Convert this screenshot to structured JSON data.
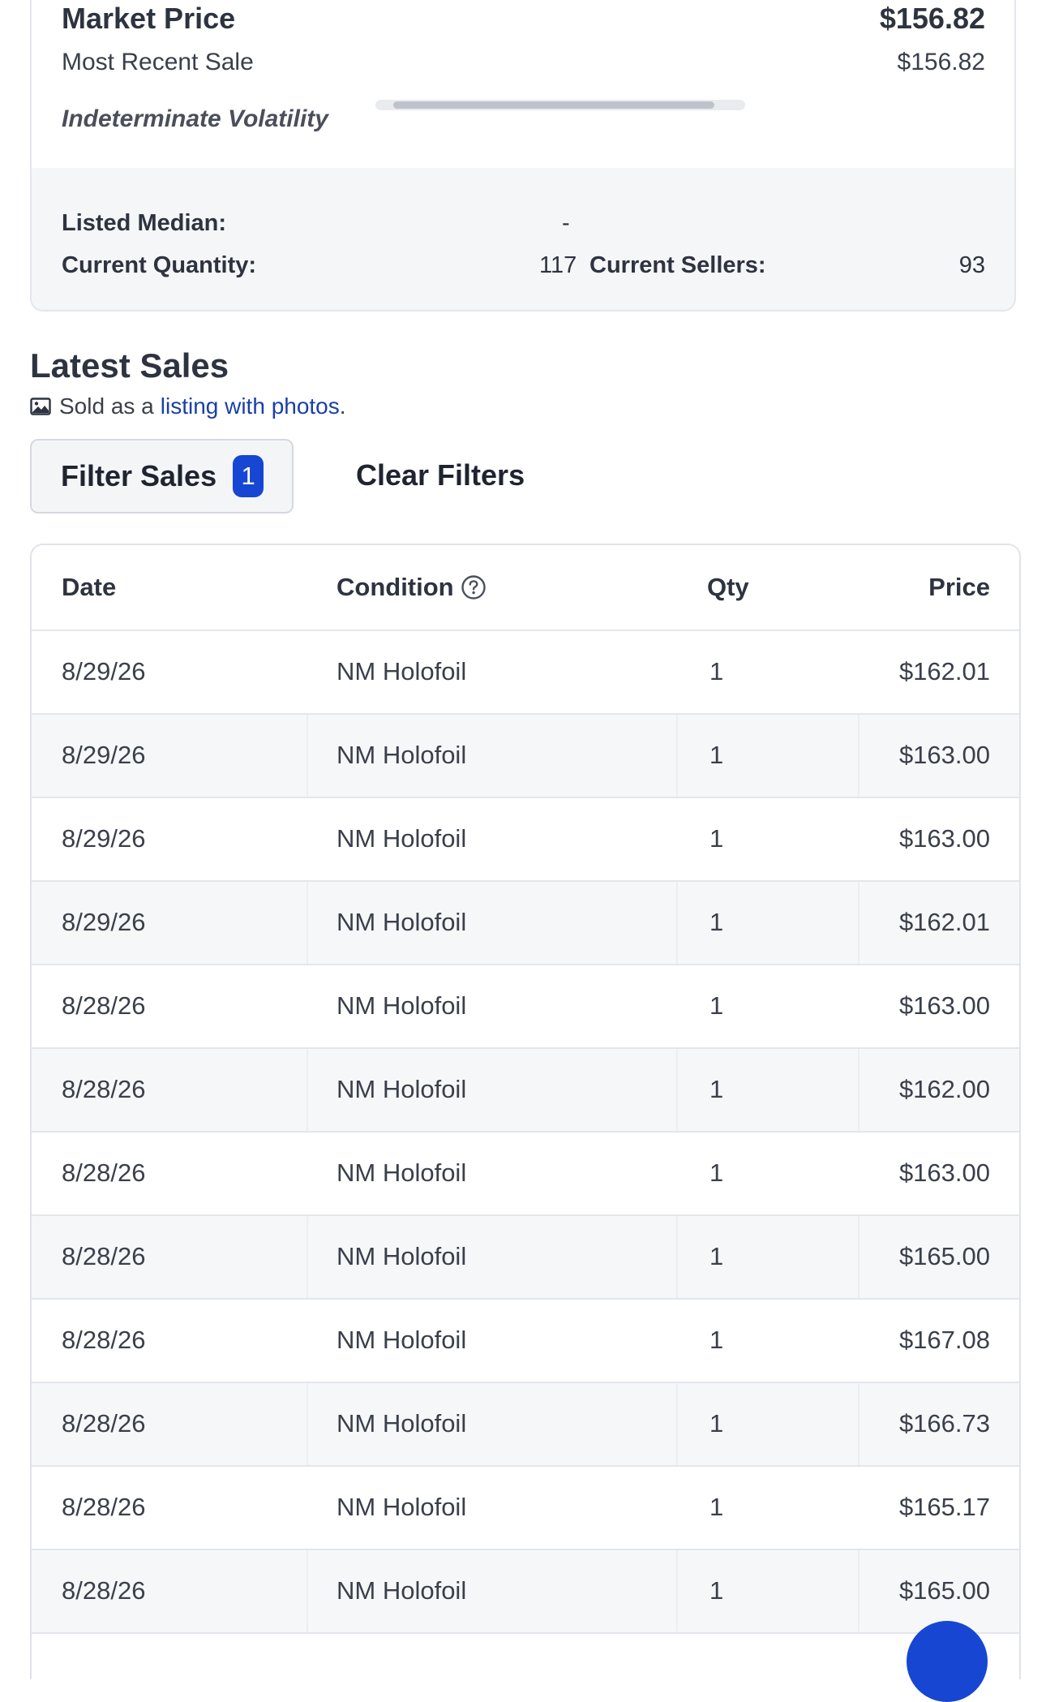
{
  "market": {
    "label": "Market Price",
    "value": "$156.82",
    "recent_label": "Most Recent Sale",
    "recent_value": "$156.82",
    "volatility_label": "Indeterminate Volatility",
    "volatility_level": 0.9
  },
  "stats": {
    "listed_median_label": "Listed Median:",
    "listed_median_value": "-",
    "quantity_label": "Current Quantity:",
    "quantity_value": "117",
    "sellers_label": "Current Sellers:",
    "sellers_value": "93"
  },
  "sales": {
    "title": "Latest Sales",
    "note_prefix": "Sold as a",
    "note_link": "listing with photos",
    "note_suffix": ".",
    "filter_label": "Filter Sales",
    "filter_count": "1",
    "clear_label": "Clear Filters",
    "columns": {
      "date": "Date",
      "condition": "Condition",
      "qty": "Qty",
      "price": "Price"
    },
    "rows": [
      {
        "date": "8/29/26",
        "condition": "NM Holofoil",
        "qty": "1",
        "price": "$162.01"
      },
      {
        "date": "8/29/26",
        "condition": "NM Holofoil",
        "qty": "1",
        "price": "$163.00"
      },
      {
        "date": "8/29/26",
        "condition": "NM Holofoil",
        "qty": "1",
        "price": "$163.00"
      },
      {
        "date": "8/29/26",
        "condition": "NM Holofoil",
        "qty": "1",
        "price": "$162.01"
      },
      {
        "date": "8/28/26",
        "condition": "NM Holofoil",
        "qty": "1",
        "price": "$163.00"
      },
      {
        "date": "8/28/26",
        "condition": "NM Holofoil",
        "qty": "1",
        "price": "$162.00"
      },
      {
        "date": "8/28/26",
        "condition": "NM Holofoil",
        "qty": "1",
        "price": "$163.00"
      },
      {
        "date": "8/28/26",
        "condition": "NM Holofoil",
        "qty": "1",
        "price": "$165.00"
      },
      {
        "date": "8/28/26",
        "condition": "NM Holofoil",
        "qty": "1",
        "price": "$167.08"
      },
      {
        "date": "8/28/26",
        "condition": "NM Holofoil",
        "qty": "1",
        "price": "$166.73"
      },
      {
        "date": "8/28/26",
        "condition": "NM Holofoil",
        "qty": "1",
        "price": "$165.17"
      },
      {
        "date": "8/28/26",
        "condition": "NM Holofoil",
        "qty": "1",
        "price": "$165.00"
      }
    ]
  },
  "colors": {
    "accent": "#1747d2",
    "link": "#1a3fa8",
    "text": "#2e3340"
  }
}
